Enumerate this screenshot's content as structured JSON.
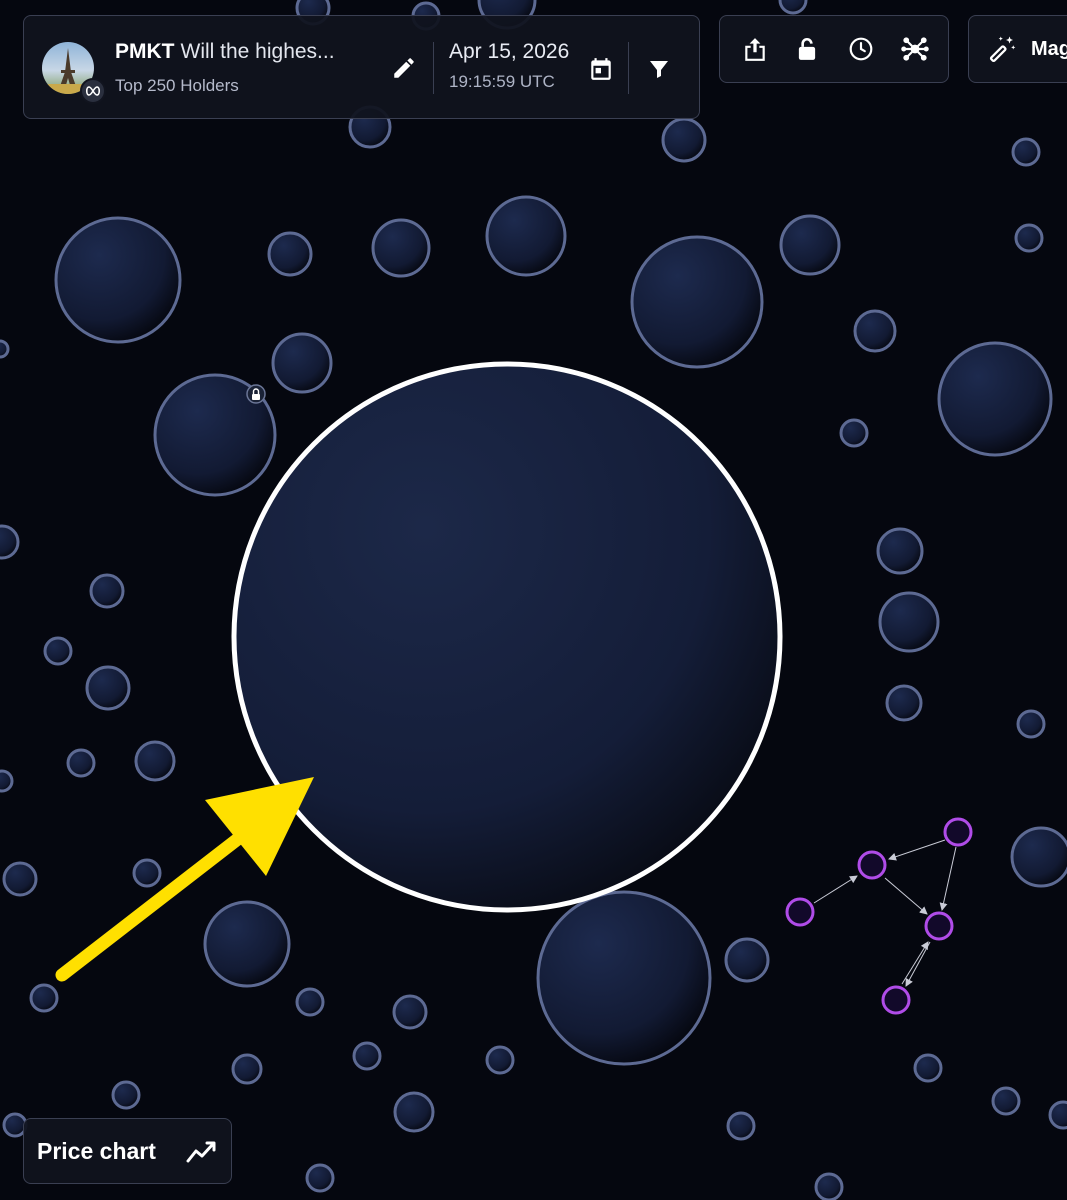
{
  "header": {
    "token_symbol": "PMKT",
    "market_title": "Will the highes...",
    "subtitle": "Top 250 Holders",
    "date": "Apr 15, 2026",
    "time": "19:15:59 UTC",
    "icons": {
      "avatar": "eiffel-tower-avatar",
      "chain": "infinity-chain-icon",
      "edit": "pencil-icon",
      "calendar": "calendar-icon",
      "filter": "filter-icon"
    }
  },
  "toolbar": {
    "icons": [
      "share-icon",
      "unlock-icon",
      "clock-icon",
      "network-icon"
    ]
  },
  "magic": {
    "label": "Mag",
    "icon": "magic-wand-icon"
  },
  "price_chart": {
    "label": "Price chart",
    "icon": "trend-line-icon"
  },
  "graph": {
    "highlight_color": "#b04ce8",
    "annotation_arrow_color": "#ffe000",
    "selected_bubble_border": "#ffffff"
  }
}
